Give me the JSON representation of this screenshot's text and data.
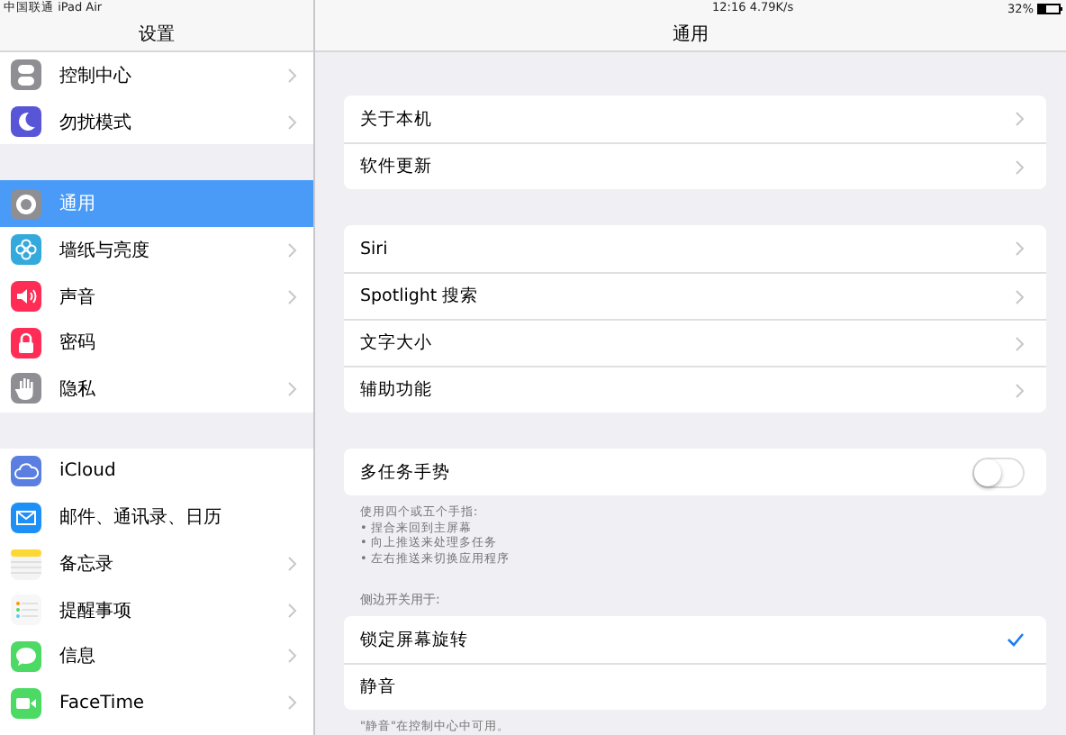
{
  "status_bar": {
    "carrier": "中国联通 iPad Air",
    "time_speed": "12:16 4.79K/s",
    "battery": "32%"
  },
  "sidebar": {
    "title": "设置",
    "groups": [
      [
        {
          "label": "控制中心",
          "kind": "switches",
          "selected": false,
          "chevron": true
        },
        {
          "label": "勿扰模式",
          "kind": "moon",
          "selected": false,
          "chevron": true
        }
      ],
      [
        {
          "label": "通用",
          "kind": "gear",
          "selected": true,
          "chevron": false
        },
        {
          "label": "墙纸与亮度",
          "kind": "flower",
          "selected": false,
          "chevron": true
        },
        {
          "label": "声音",
          "kind": "speaker",
          "selected": false,
          "chevron": true
        },
        {
          "label": "密码",
          "kind": "lock",
          "selected": false,
          "chevron": false
        },
        {
          "label": "隐私",
          "kind": "hand",
          "selected": false,
          "chevron": true
        }
      ],
      [
        {
          "label": "iCloud",
          "kind": "cloud",
          "selected": false,
          "chevron": false
        },
        {
          "label": "邮件、通讯录、日历",
          "kind": "envelope",
          "selected": false,
          "chevron": false
        },
        {
          "label": "备忘录",
          "kind": "notes",
          "selected": false,
          "chevron": true
        },
        {
          "label": "提醒事项",
          "kind": "checklist",
          "selected": false,
          "chevron": true
        },
        {
          "label": "信息",
          "kind": "bubble",
          "selected": false,
          "chevron": true
        },
        {
          "label": "FaceTime",
          "kind": "camera",
          "selected": false,
          "chevron": true
        }
      ]
    ]
  },
  "detail": {
    "title": "通用",
    "sections": [
      {
        "rows": [
          {
            "label": "关于本机",
            "kind": "link"
          },
          {
            "label": "软件更新",
            "kind": "link"
          }
        ]
      },
      {
        "rows": [
          {
            "label": "Siri",
            "kind": "link"
          },
          {
            "label": "Spotlight 搜索",
            "kind": "link"
          },
          {
            "label": "文字大小",
            "kind": "link"
          },
          {
            "label": "辅助功能",
            "kind": "link"
          }
        ]
      },
      {
        "rows": [
          {
            "label": "多任务手势",
            "kind": "toggle",
            "on": false
          }
        ],
        "footer": [
          "使用四个或五个手指:",
          "• 捏合来回到主屏幕",
          "• 向上推送来处理多任务",
          "• 左右推送来切换应用程序"
        ]
      },
      {
        "header": "侧边开关用于:",
        "rows": [
          {
            "label": "锁定屏幕旋转",
            "kind": "option",
            "selected": true
          },
          {
            "label": "静音",
            "kind": "option",
            "selected": false
          }
        ],
        "footer": [
          "\"静音\"在控制中心中可用。"
        ]
      }
    ]
  }
}
